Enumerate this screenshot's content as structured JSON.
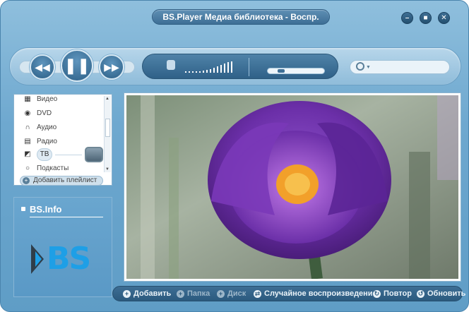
{
  "window": {
    "title": "BS.Player Медиа библиотека - Воспр."
  },
  "controls": {
    "minimize_icon": "minus-icon",
    "maximize_icon": "square-icon",
    "close_icon": "x-icon"
  },
  "library": {
    "items": [
      {
        "label": "Видео",
        "icon": "film-icon"
      },
      {
        "label": "DVD",
        "icon": "disc-icon"
      },
      {
        "label": "Аудио",
        "icon": "headphones-icon"
      },
      {
        "label": "Радио",
        "icon": "radio-icon"
      },
      {
        "label": "ТВ",
        "icon": "tv-icon"
      },
      {
        "label": "Подкасты",
        "icon": "podcast-icon"
      }
    ],
    "add_playlist_label": "Добавить плейлист"
  },
  "info": {
    "title": "BS.Info",
    "logo_text": "BS"
  },
  "bottombar": {
    "add_label": "Добавить",
    "folder_label": "Папка",
    "disc_label": "Диск",
    "shuffle_label": "Случайное воспроизведение",
    "repeat_label": "Повтор",
    "refresh_label": "Обновить"
  },
  "colors": {
    "window_bg": "#6ea8cf",
    "accent_dark": "#2b5a7e",
    "logo_blue": "#1e9fe6"
  }
}
